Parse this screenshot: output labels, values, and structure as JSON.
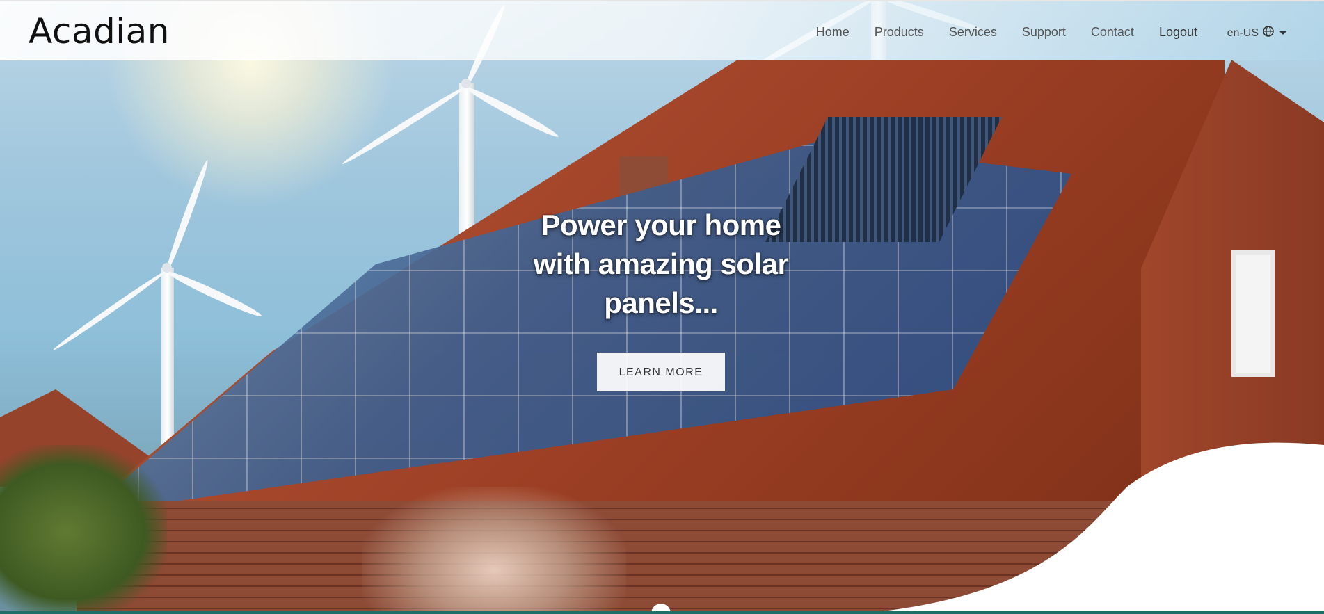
{
  "header": {
    "brand": "Acadian",
    "nav": [
      {
        "label": "Home"
      },
      {
        "label": "Products"
      },
      {
        "label": "Services"
      },
      {
        "label": "Support"
      },
      {
        "label": "Contact"
      },
      {
        "label": "Logout"
      }
    ],
    "language": {
      "label": "en-US",
      "icon": "globe-icon"
    }
  },
  "hero": {
    "title_line1": "Power your home",
    "title_line2": "with amazing solar",
    "title_line3": "panels...",
    "cta_label": "LEARN MORE",
    "background_image": "rooftop-solar-panels-wind-turbines"
  },
  "colors": {
    "accent": "#1f6e68",
    "text": "#555555",
    "cta_background": "#ffffff"
  }
}
